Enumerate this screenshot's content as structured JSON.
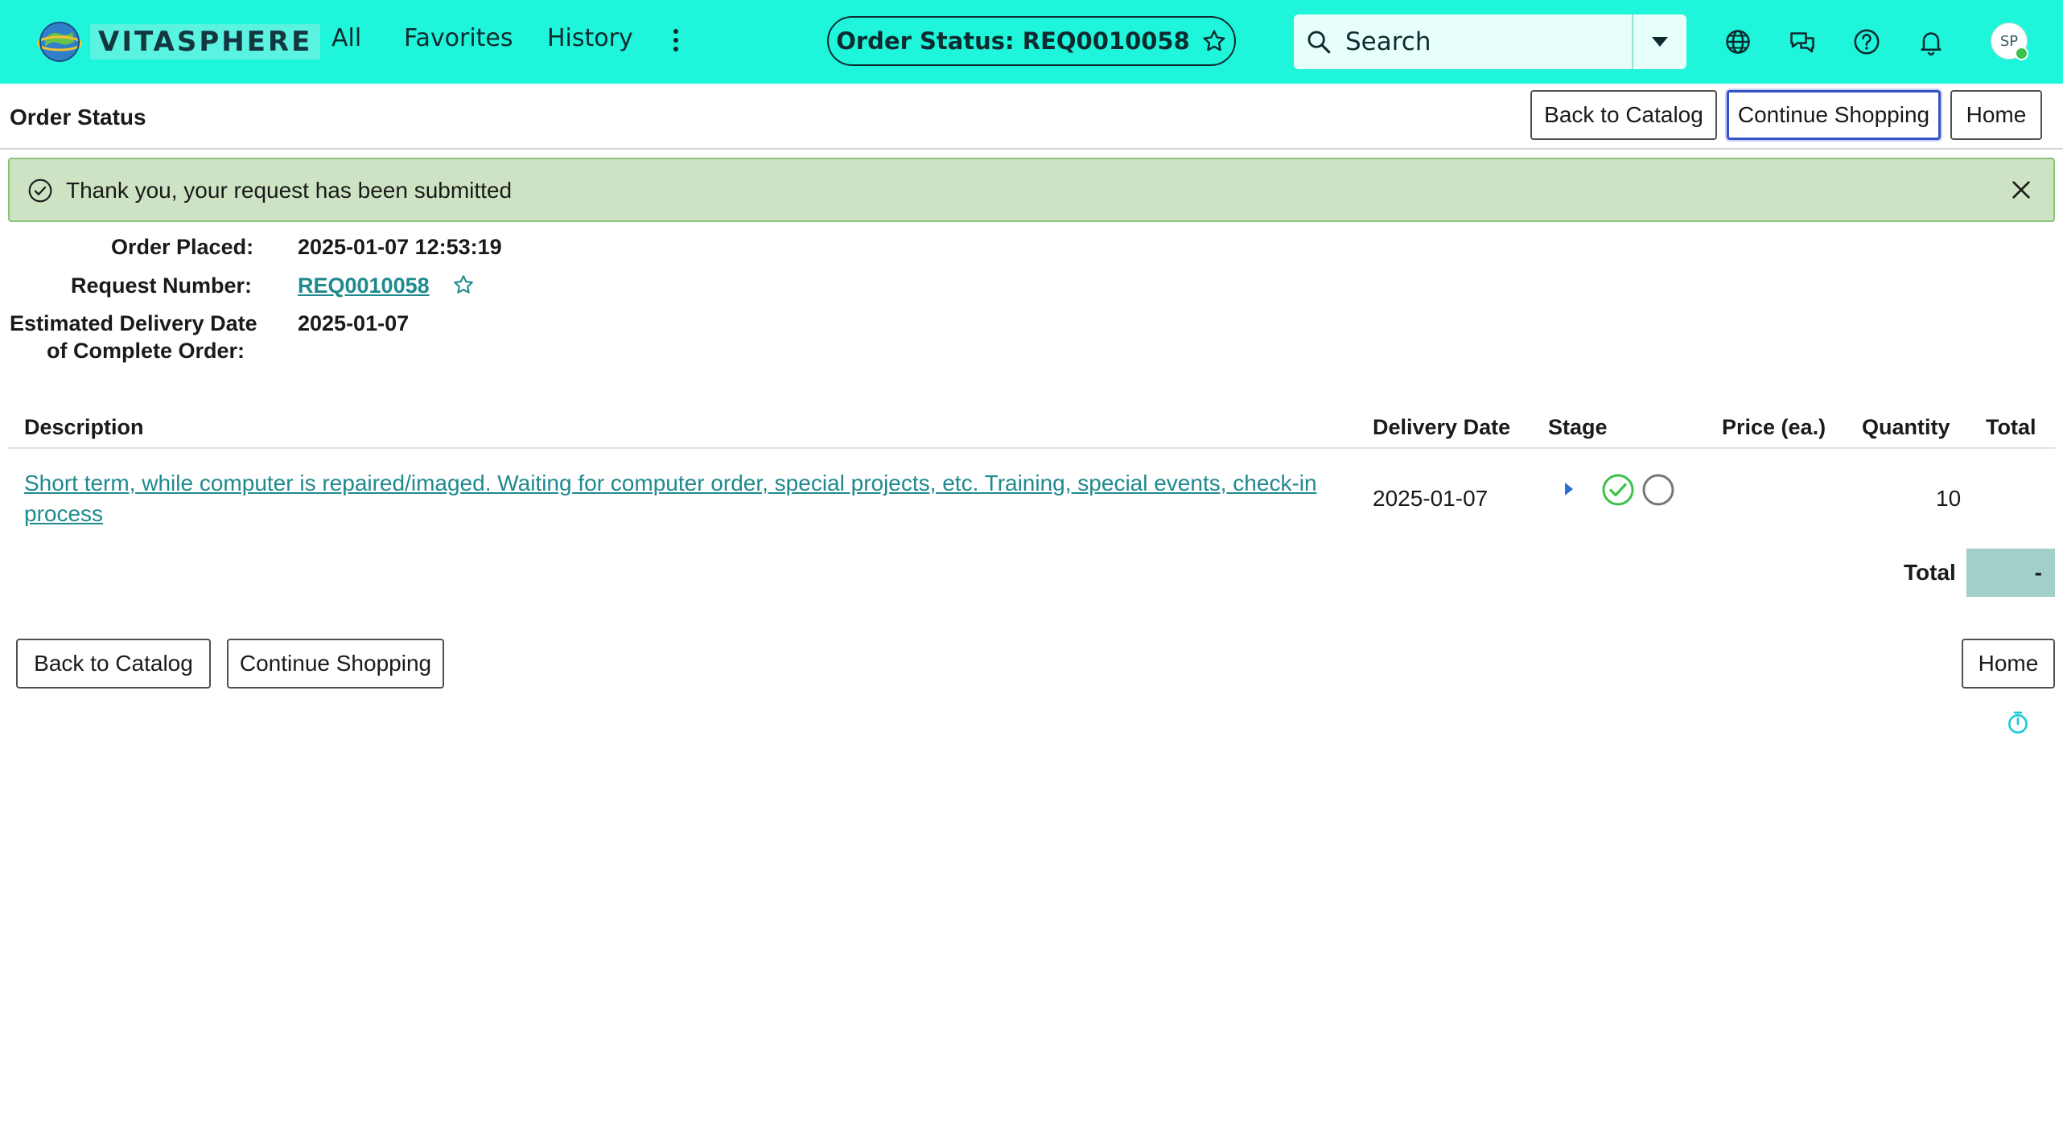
{
  "colors": {
    "topbar": "#1ef5da",
    "link": "#1f8a8e",
    "alert_bg": "#cde3c3",
    "stage_done": "#3cc04a",
    "total_bg": "#a0d0c8"
  },
  "header": {
    "brand": "VITASPHERE",
    "nav": [
      "All",
      "Favorites",
      "History"
    ],
    "more_icon": "more-vertical-icon",
    "context_title": "Order Status: REQ0010058",
    "search_placeholder": "Search",
    "icons": [
      "globe-icon",
      "chat-icon",
      "help-icon",
      "bell-icon"
    ],
    "avatar_initials": "SP"
  },
  "page": {
    "title": "Order Status",
    "buttons": {
      "back_to_catalog": "Back to Catalog",
      "continue_shopping": "Continue Shopping",
      "home": "Home"
    }
  },
  "alert": {
    "message": "Thank you, your request has been submitted"
  },
  "order": {
    "placed_label": "Order Placed:",
    "placed_value": "2025-01-07 12:53:19",
    "request_label": "Request Number:",
    "request_value": "REQ0010058",
    "delivery_label_line1": "Estimated Delivery Date",
    "delivery_label_line2": "of Complete Order:",
    "delivery_value": "2025-01-07"
  },
  "table": {
    "columns": [
      "Description",
      "Delivery Date",
      "Stage",
      "Price (ea.)",
      "Quantity",
      "Total"
    ],
    "rows": [
      {
        "description": "Short term, while computer is repaired/imaged. Waiting for computer order, special projects, etc. Training, special events, check-in process",
        "delivery_date": "2025-01-07",
        "stages": [
          "completed",
          "pending"
        ],
        "price": "",
        "quantity": "10",
        "total": ""
      }
    ],
    "total_label": "Total",
    "total_value": "-"
  }
}
